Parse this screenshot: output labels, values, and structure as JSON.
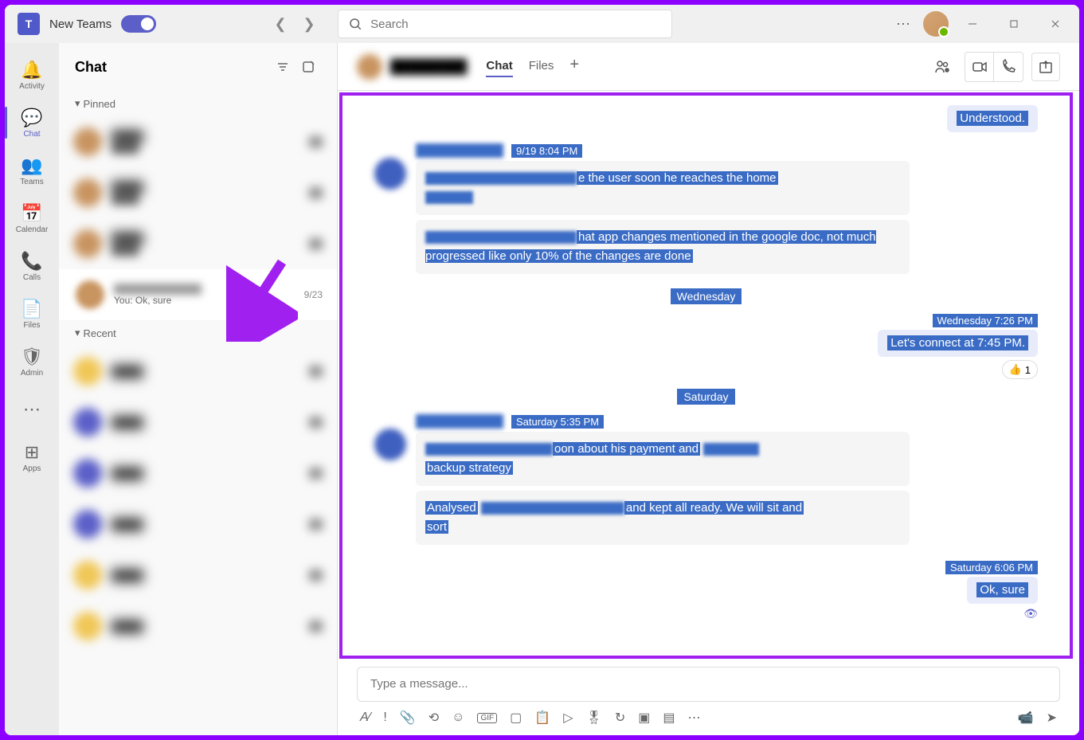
{
  "titlebar": {
    "app_name": "New Teams",
    "search_placeholder": "Search"
  },
  "rail": {
    "activity": "Activity",
    "chat": "Chat",
    "teams": "Teams",
    "calendar": "Calendar",
    "calls": "Calls",
    "files": "Files",
    "admin": "Admin",
    "apps": "Apps"
  },
  "chatlist": {
    "title": "Chat",
    "pinned_label": "Pinned",
    "recent_label": "Recent",
    "active_item": {
      "name": "████████",
      "preview": "You: Ok, sure",
      "date": "9/23"
    }
  },
  "chat_header": {
    "tabs": {
      "chat": "Chat",
      "files": "Files"
    }
  },
  "conversation": {
    "msg_understood": {
      "text": "Understood."
    },
    "msg1": {
      "time": "9/19 8:04 PM",
      "line1_suffix": "e the user soon he reaches the home",
      "line2_suffix": "hat app changes mentioned in the google doc, not much progressed like only 10% of the changes are done"
    },
    "sep_wed": "Wednesday",
    "msg_wed_out": {
      "time": "Wednesday 7:26 PM",
      "text": "Let's connect at 7:45 PM.",
      "reaction_count": "1"
    },
    "sep_sat": "Saturday",
    "msg_sat_in": {
      "time": "Saturday 5:35 PM",
      "b1_suffix": "oon about his payment and",
      "b1_line2": "backup strategy",
      "b2_prefix": "Analysed",
      "b2_suffix": "and kept all ready. We will sit and",
      "b2_line2": "sort"
    },
    "msg_sat_out": {
      "time": "Saturday 6:06 PM",
      "text": "Ok, sure"
    }
  },
  "composer": {
    "placeholder": "Type a message..."
  }
}
